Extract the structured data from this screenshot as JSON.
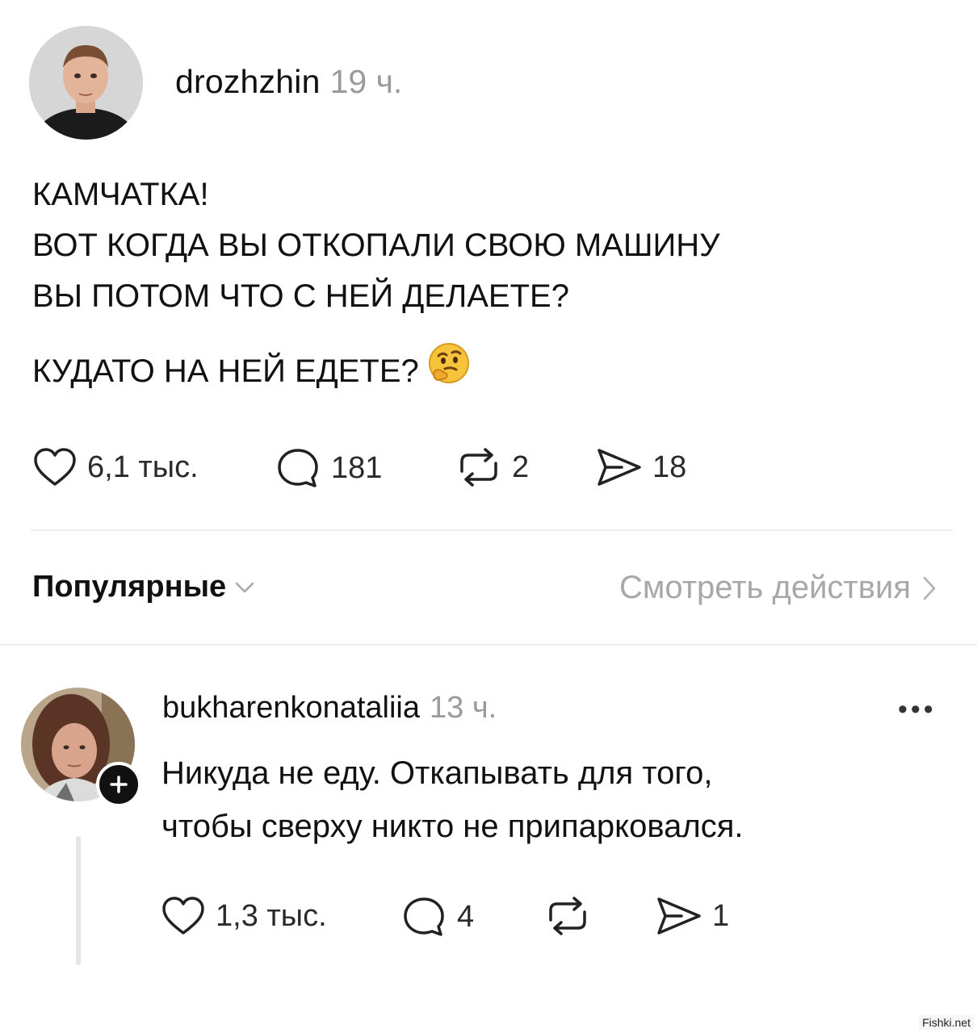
{
  "post": {
    "username": "drozhzhin",
    "time": "19 ч.",
    "lines": [
      "КАМЧАТКА!",
      "ВОТ КОГДА ВЫ ОТКОПАЛИ СВОЮ МАШИНУ",
      "ВЫ ПОТОМ ЧТО С НЕЙ ДЕЛАЕТЕ?",
      "КУДАТО НА НЕЙ ЕДЕТЕ?"
    ],
    "emoji": "thinking-face",
    "likes": "6,1 тыс.",
    "comments": "181",
    "reposts": "2",
    "shares": "18"
  },
  "toolbar": {
    "sort_label": "Популярные",
    "view_activity": "Смотреть действия"
  },
  "reply": {
    "username": "bukharenkonataliia",
    "time": "13 ч.",
    "lines": [
      "Никуда не еду. Откапывать для того,",
      "чтобы сверху никто не припарковался."
    ],
    "likes": "1,3 тыс.",
    "comments": "4",
    "reposts": "",
    "shares": "1",
    "more": "•••"
  },
  "watermark": "Fishki.net",
  "colors": {
    "text": "#111111",
    "muted": "#9a9a9a",
    "divider": "#ececec",
    "emoji": "#f7c33d"
  }
}
